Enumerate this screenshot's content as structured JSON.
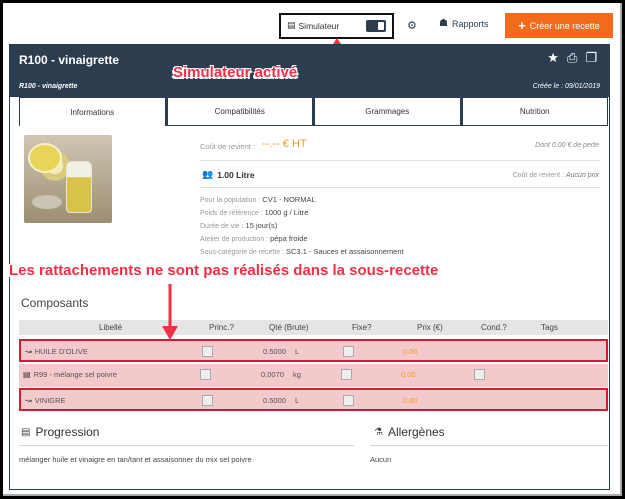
{
  "toolbar": {
    "simulator_label": "Simulateur",
    "simulator_icon": "calculator-icon",
    "settings_icon": "gear-icon",
    "reports_label": "Rapports",
    "reports_icon": "reports-icon",
    "create_label": "Créer une recette",
    "create_icon": "plus-icon",
    "accent_color": "#f26b1d"
  },
  "header": {
    "title": "R100 - vinaigrette",
    "subtitle": "R100 - vinaigrette",
    "created": "Créée le : 09/01/2019",
    "icons": [
      "star-icon",
      "print-icon",
      "copy-icon"
    ],
    "background": "#2c3d50"
  },
  "tabs": [
    {
      "label": "Informations",
      "active": true
    },
    {
      "label": "Compatibilités",
      "active": false
    },
    {
      "label": "Grammages",
      "active": false
    },
    {
      "label": "Nutrition",
      "active": false
    }
  ],
  "info": {
    "cost_label": "Coût de revient :",
    "cost_value": "--.-- € HT",
    "loss_text": "Dont 0.00 € de perte",
    "quantity": "1.00 Litre",
    "quantity_icon": "people-icon",
    "cost_label2": "Coût de revient :",
    "cost_value2": "Aucun prix",
    "population_label": "Pour la population :",
    "population_value": "CV1 - NORMAL",
    "weight_label": "Poids de référence :",
    "weight_value": "1000 g / Litre",
    "life_label": "Durée de vie :",
    "life_value": "15 jour(s)",
    "workshop_label": "Atelier de production :",
    "workshop_value": "pépa froide",
    "subcategory_label": "Sous-catégorie de recette :",
    "subcategory_value": "SC3.1 - Sauces et assaisonnement"
  },
  "annotations": {
    "simulator_active": "Simulateur activé",
    "not_linked": "Les rattachements ne sont pas réalisés dans la sous-recette",
    "color": "#f42f45"
  },
  "composants": {
    "title": "Composants",
    "headers": [
      "Libellé",
      "Princ.?",
      "Qté (Brute)",
      "Fixe?",
      "Prix (€)",
      "Cond.?",
      "Tags"
    ],
    "rows": [
      {
        "icon": "ingredient-icon",
        "name": "HUILE D'OLIVE",
        "qty": "0.5000",
        "unit": "L",
        "price": "0.00",
        "highlight": true,
        "cond": false
      },
      {
        "icon": "subrecipe-icon",
        "name": "R99 - mélange sel poivre",
        "qty": "0.0070",
        "unit": "kg",
        "price": "0.00",
        "highlight": false,
        "cond": true
      },
      {
        "icon": "ingredient-icon",
        "name": "VINIGRE",
        "qty": "0.5000",
        "unit": "L",
        "price": "0.00",
        "highlight": true,
        "cond": false
      }
    ]
  },
  "progression": {
    "title": "Progression",
    "icon": "list-icon",
    "text": "mélanger huile et vinaigre en tan/tant et assaisonner du mix sel poivre"
  },
  "allergenes": {
    "title": "Allergènes",
    "icon": "flask-icon",
    "text": "Aucun"
  }
}
